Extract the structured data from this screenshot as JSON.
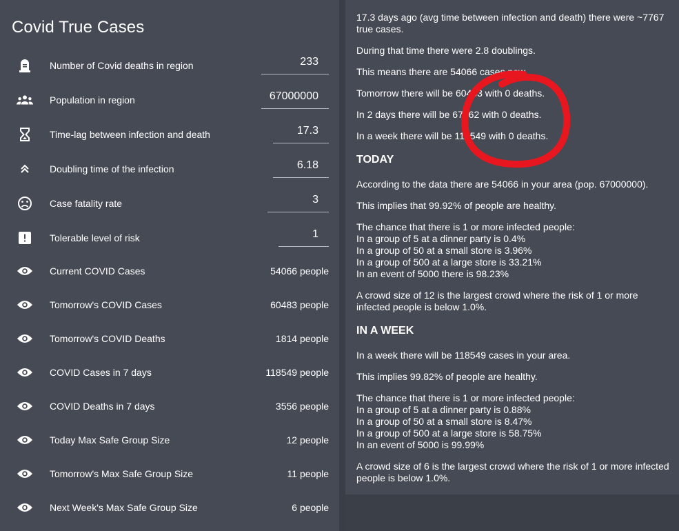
{
  "app": {
    "title": "Covid True Cases"
  },
  "inputs": [
    {
      "label": "Number of Covid deaths in region",
      "value": "233",
      "icon": "tombstone-icon"
    },
    {
      "label": "Population in region",
      "value": "67000000",
      "icon": "people-group-icon"
    },
    {
      "label": "Time-lag between infection and death",
      "value": "17.3",
      "icon": "hourglass-icon"
    },
    {
      "label": "Doubling time of the infection",
      "value": "6.18",
      "icon": "double-chevron-up-icon"
    },
    {
      "label": "Case fatality rate",
      "value": "3",
      "icon": "sad-face-icon"
    },
    {
      "label": "Tolerable level of risk",
      "value": "1",
      "icon": "alert-icon"
    }
  ],
  "outputs": [
    {
      "label": "Current COVID Cases",
      "value": "54066 people",
      "icon": "eye-icon"
    },
    {
      "label": "Tomorrow's COVID Cases",
      "value": "60483 people",
      "icon": "eye-icon"
    },
    {
      "label": "Tomorrow's COVID Deaths",
      "value": "1814 people",
      "icon": "eye-icon"
    },
    {
      "label": "COVID Cases in 7 days",
      "value": "118549 people",
      "icon": "eye-icon"
    },
    {
      "label": "COVID Deaths in 7 days",
      "value": "3556 people",
      "icon": "eye-icon"
    },
    {
      "label": "Today Max Safe Group Size",
      "value": "12 people",
      "icon": "eye-icon"
    },
    {
      "label": "Tomorrow's Max Safe Group Size",
      "value": "11 people",
      "icon": "eye-icon"
    },
    {
      "label": "Next Week's Max Safe Group Size",
      "value": "6 people",
      "icon": "eye-icon"
    }
  ],
  "summary": {
    "intro_1": "17.3 days ago (avg time between infection and death) there were ~7767 true cases.",
    "intro_2": "During that time there were 2.8 doublings.",
    "intro_3": "This means there are 54066 cases now.",
    "intro_4": "Tomorrow there will be 60483 with 0 deaths.",
    "intro_5": "In 2 days there will be 67662 with 0 deaths.",
    "intro_6": "In a week there will be 118549 with 0 deaths."
  },
  "today": {
    "heading": "TODAY",
    "p1": "According to the data there are 54066 in your area (pop. 67000000).",
    "p2": "This implies that 99.92% of people are healthy.",
    "chance_lines": [
      "The chance that there is 1 or more infected people:",
      "In a group of 5 at a dinner party is 0.4%",
      "In a group of 50 at a small store is 3.96%",
      "In a group of 500 at a large store is 33.21%",
      "In an event of 5000 there is 98.23%"
    ],
    "crowd_lines": [
      "A crowd size of 12 is the largest crowd where the risk of 1 or more",
      "infected people is below 1.0%."
    ]
  },
  "week": {
    "heading": "IN A WEEK",
    "p1": "In a week there will be 118549 cases in your area.",
    "p2": "This implies 99.82% of people are healthy.",
    "chance_lines": [
      "The chance that there is 1 or more infected people:",
      "In a group of 5 at a dinner party is 0.88%",
      "In a group of 50 at a small store is 8.47%",
      "In a group of 500 at a large store is 58.75%",
      "In an event of 5000 is 99.99%"
    ],
    "crowd_lines": [
      "A crowd size of 6 is the largest crowd where the risk of 1 or more infected",
      "people is below 1.0%."
    ]
  },
  "colors": {
    "panel": "#454a54",
    "background": "#393d45",
    "annotation": "#e8171f"
  }
}
